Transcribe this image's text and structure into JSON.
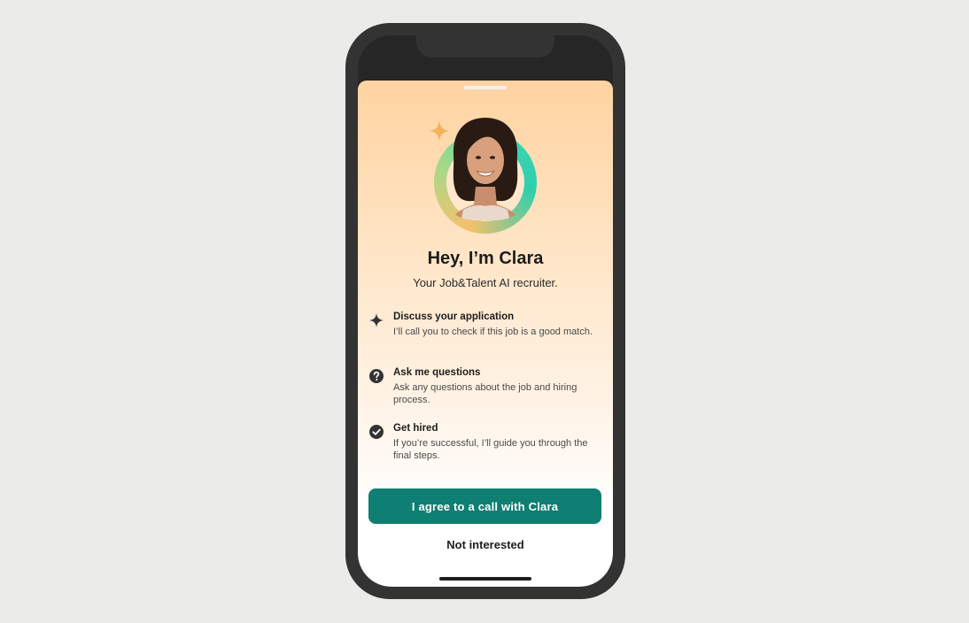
{
  "sheet": {
    "title": "Hey, I’m Clara",
    "subtitle": "Your Job&Talent AI recruiter."
  },
  "features": [
    {
      "icon": "sparkle-icon",
      "heading": "Discuss your application",
      "body": "I’ll call you to check if this job is a good match."
    },
    {
      "icon": "question-circle-icon",
      "heading": "Ask me questions",
      "body": "Ask any questions about the job and hiring process."
    },
    {
      "icon": "check-circle-icon",
      "heading": "Get hired",
      "body": "If you’re successful, I’ll guide you through the final steps."
    }
  ],
  "actions": {
    "primary_label": "I agree to a call with Clara",
    "secondary_label": "Not interested"
  },
  "colors": {
    "accent": "#0e7f72",
    "sparkle": "#f6b25a",
    "background": "#ebecea"
  }
}
